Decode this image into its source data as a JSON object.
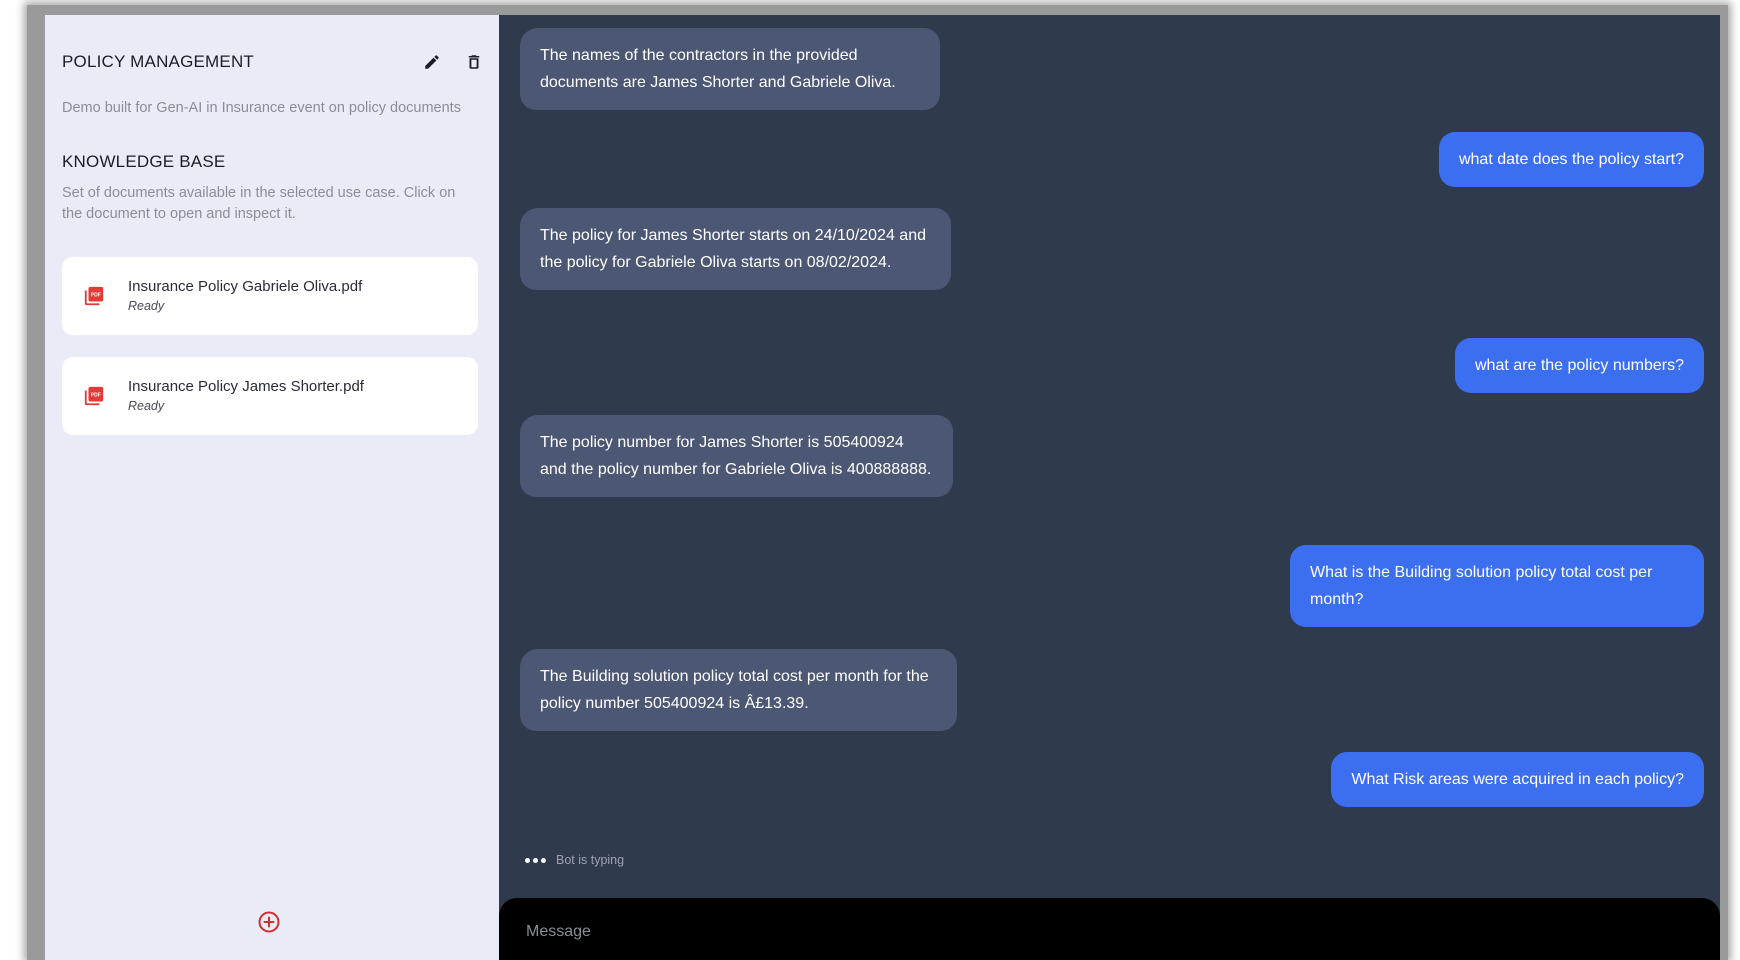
{
  "sidebar": {
    "title": "POLICY MANAGEMENT",
    "description": "Demo built for Gen-AI in Insurance event on policy documents",
    "knowledge_base": {
      "title": "KNOWLEDGE BASE",
      "description": "Set of documents available in the selected use case. Click on the document to open and inspect it."
    },
    "documents": [
      {
        "name": "Insurance Policy Gabriele Oliva.pdf",
        "status": "Ready",
        "icon": "pdf-icon"
      },
      {
        "name": "Insurance Policy James Shorter.pdf",
        "status": "Ready",
        "icon": "pdf-icon"
      }
    ],
    "icons": {
      "edit": "pencil-icon",
      "delete": "trash-icon",
      "add": "add-circle-icon"
    },
    "colors": {
      "pdf": "#e53935",
      "add": "#d32f2f"
    }
  },
  "chat": {
    "messages": [
      {
        "role": "bot",
        "text": "The names of the contractors in the provided documents are James Shorter and Gabriele Oliva."
      },
      {
        "role": "user",
        "text": "what date does the policy start?"
      },
      {
        "role": "bot",
        "text": "The policy for James Shorter starts on 24/10/2024 and the policy for Gabriele Oliva starts on 08/02/2024."
      },
      {
        "role": "user",
        "text": "what are the policy numbers?"
      },
      {
        "role": "bot",
        "text": "The policy number for James Shorter is 505400924 and the policy number for Gabriele Oliva is 400888888."
      },
      {
        "role": "user",
        "text": "What is the Building solution policy total cost per month?"
      },
      {
        "role": "bot",
        "text": "The Building solution policy total cost per month for the policy number 505400924 is Â£13.39."
      },
      {
        "role": "user",
        "text": "What Risk areas were acquired in each policy?"
      }
    ],
    "typing_label": "Bot is typing",
    "input": {
      "placeholder": "Message",
      "value": ""
    },
    "colors": {
      "background": "#303a4d",
      "bot_bubble": "#4b5773",
      "user_bubble": "#3b6ff0",
      "composer": "#000000"
    }
  }
}
